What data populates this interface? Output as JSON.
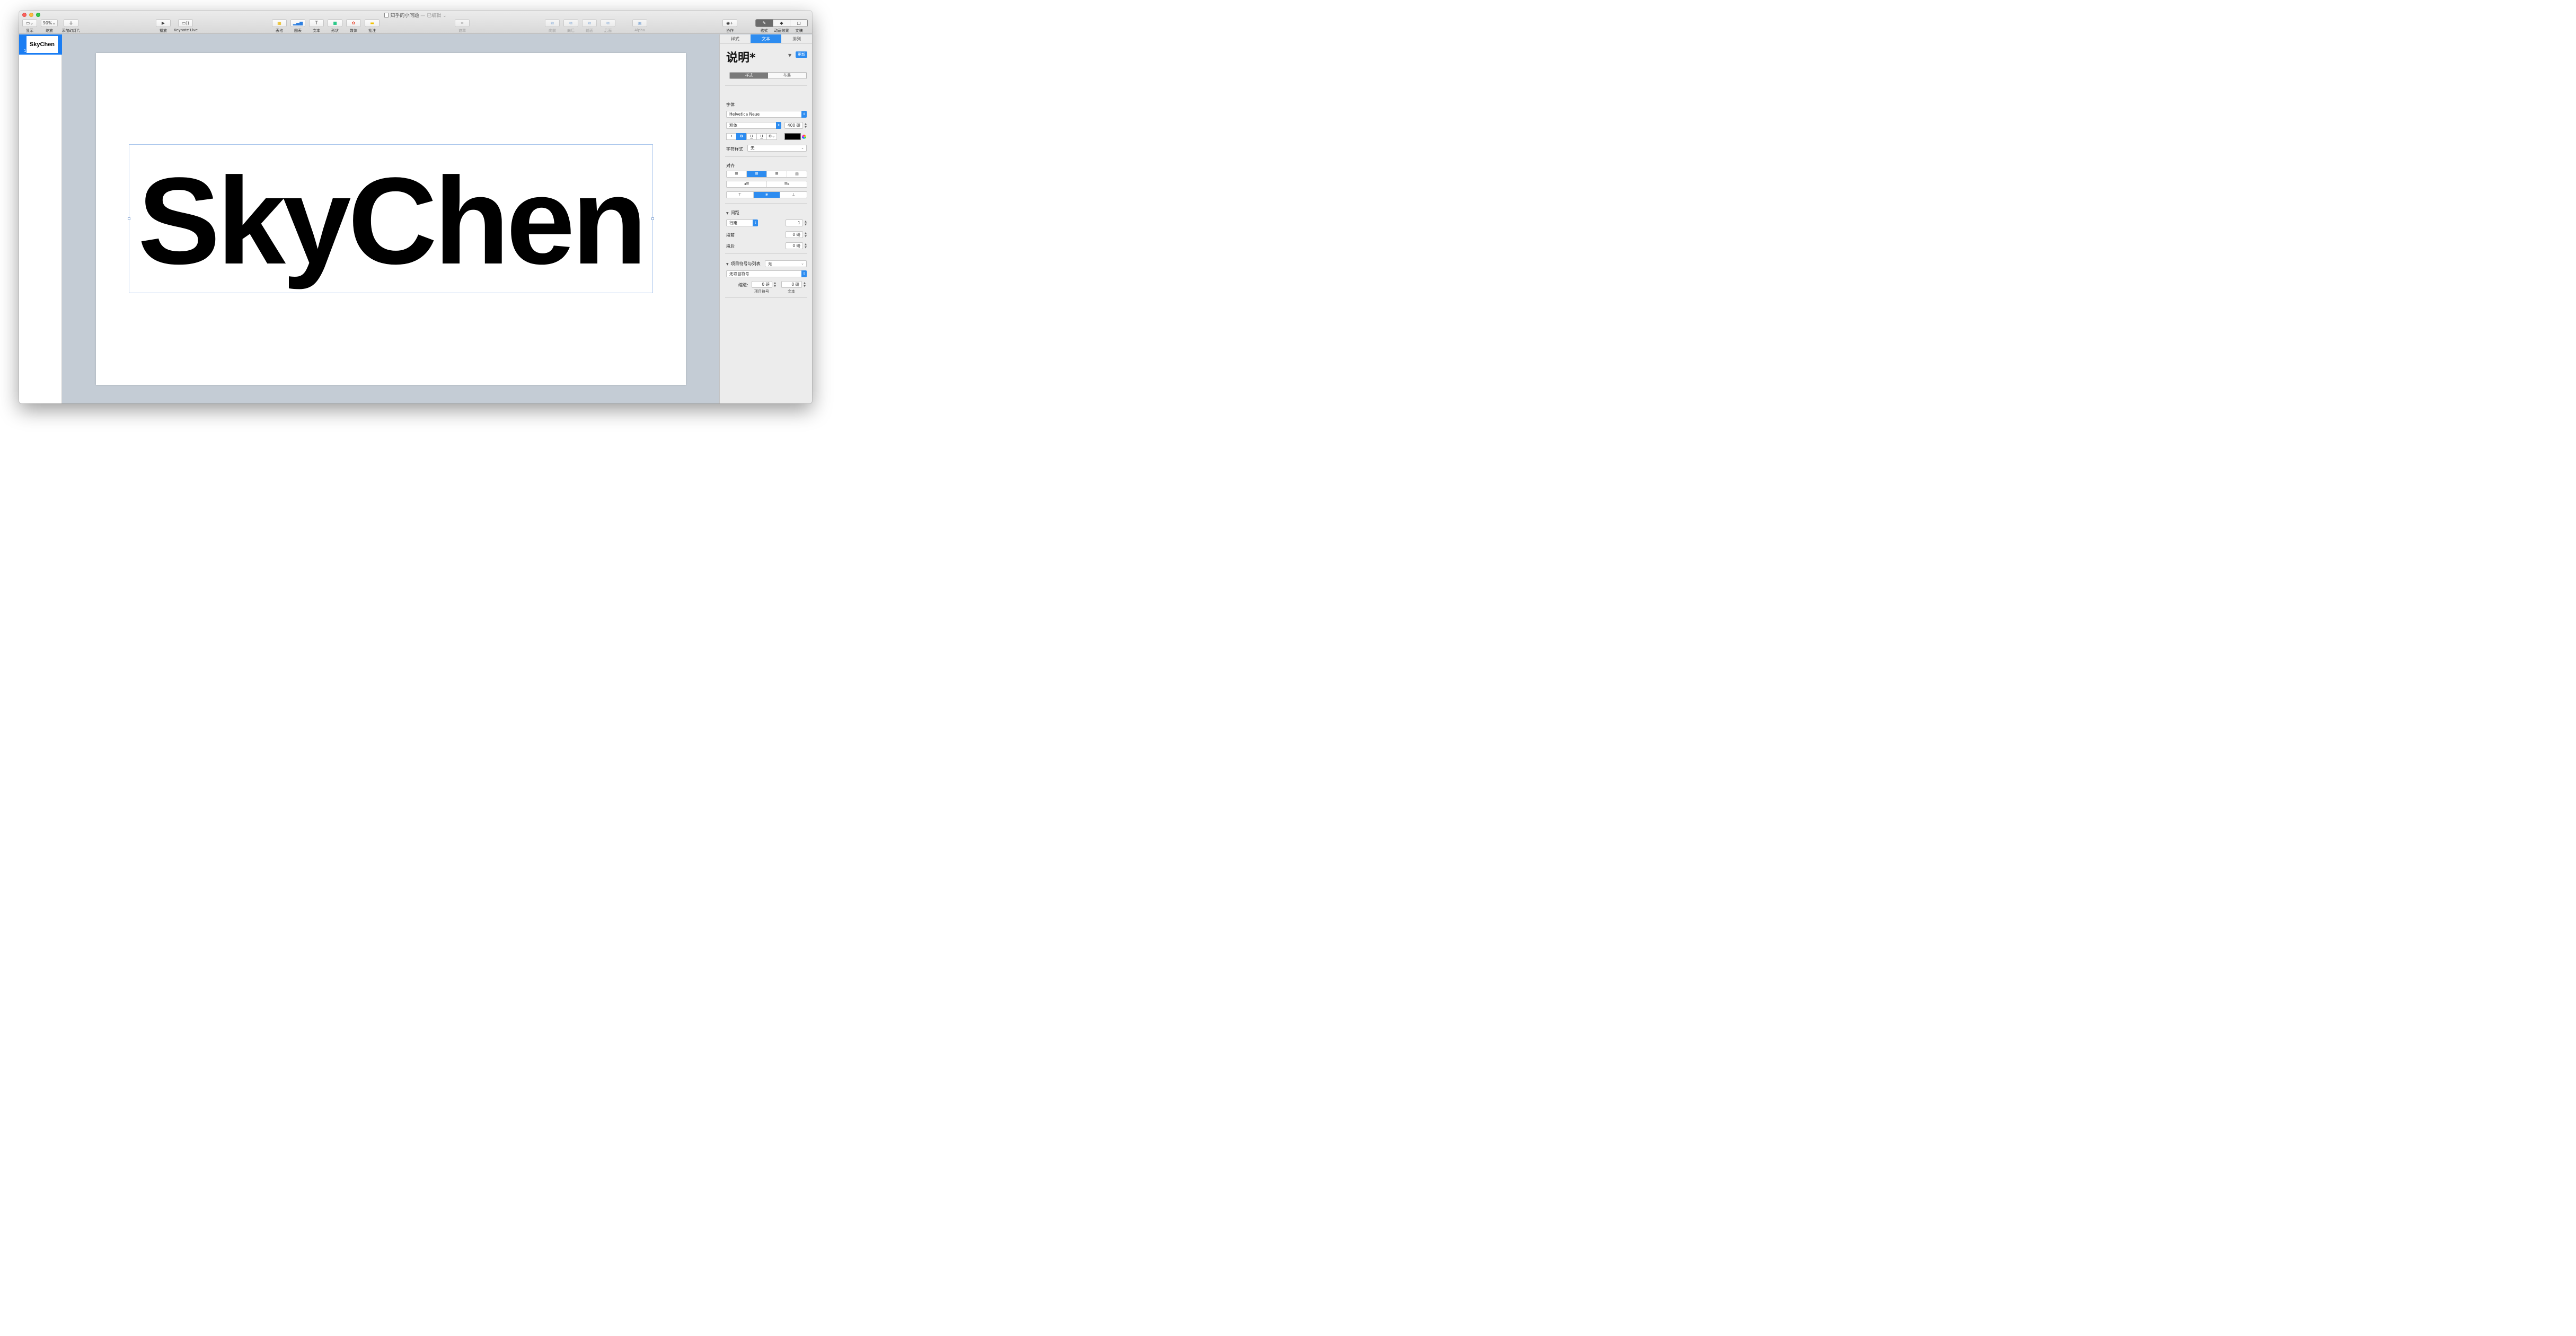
{
  "window": {
    "document_title": "知乎的小问题",
    "document_status": "— 已编辑"
  },
  "toolbar": {
    "view": {
      "label": "显示",
      "icon": "sidebar-view-icon"
    },
    "zoom": {
      "label": "缩放",
      "value": "90%"
    },
    "add_slide": {
      "label": "添加幻灯片",
      "icon": "plus-icon"
    },
    "play": {
      "label": "播放",
      "icon": "play-icon"
    },
    "keynote_live": {
      "label": "Keynote Live",
      "icon": "keynote-live-icon"
    },
    "table": {
      "label": "表格",
      "icon": "table-icon"
    },
    "chart": {
      "label": "图表",
      "icon": "chart-icon"
    },
    "text": {
      "label": "文本",
      "icon": "text-icon"
    },
    "shape": {
      "label": "形状",
      "icon": "shape-icon"
    },
    "media": {
      "label": "媒体",
      "icon": "media-icon"
    },
    "comment": {
      "label": "批注",
      "icon": "comment-icon"
    },
    "mask": {
      "label": "遮罩",
      "icon": "mask-icon"
    },
    "forward": {
      "label": "向前",
      "icon": "bring-forward-icon"
    },
    "backward": {
      "label": "向后",
      "icon": "send-backward-icon"
    },
    "front": {
      "label": "前面",
      "icon": "bring-to-front-icon"
    },
    "back": {
      "label": "后面",
      "icon": "send-to-back-icon"
    },
    "alpha": {
      "label": "Alpha",
      "icon": "alpha-icon"
    },
    "collaborate": {
      "label": "协作",
      "icon": "collaborate-icon"
    },
    "format": {
      "label": "格式",
      "icon": "paintbrush-icon"
    },
    "animate": {
      "label": "动画效果",
      "icon": "animate-icon"
    },
    "document": {
      "label": "文稿",
      "icon": "document-icon"
    }
  },
  "navigator": {
    "slides": [
      {
        "number": "1",
        "thumb_text": "SkyChen"
      }
    ]
  },
  "slide": {
    "text": "SkyChen"
  },
  "inspector": {
    "tabs": [
      "样式",
      "文本",
      "排列"
    ],
    "active_tab": "文本",
    "paragraph_style": "说明*",
    "update_label": "更新",
    "sub_tabs": [
      "样式",
      "布局"
    ],
    "font": {
      "section_label": "字体",
      "family": "Helvetica Neue",
      "typeface": "粗体",
      "size": "400 磅",
      "bullet": "•",
      "bold": "B",
      "underline": "U",
      "double_underline": "U",
      "gear": "⚙",
      "color": "#000000",
      "char_style_label": "字符样式",
      "char_style_value": "无"
    },
    "alignment": {
      "section_label": "对齐"
    },
    "spacing": {
      "section_label": "间距",
      "line_spacing_label": "行距",
      "line_spacing_value": "1",
      "before_label": "段前",
      "before_value": "0 磅",
      "after_label": "段后",
      "after_value": "0 磅"
    },
    "bullets": {
      "section_label": "项目符号与列表",
      "list_value": "无",
      "bullet_style": "无项目符号",
      "indent_label": "缩进:",
      "bullet_indent": "0 磅",
      "text_indent": "0 磅",
      "bullet_caption": "项目符号",
      "text_caption": "文本"
    }
  },
  "colors": {
    "accent": "#2d8cf0",
    "canvas": "#c4ccd5",
    "toolbar": "#e2e2e2"
  }
}
